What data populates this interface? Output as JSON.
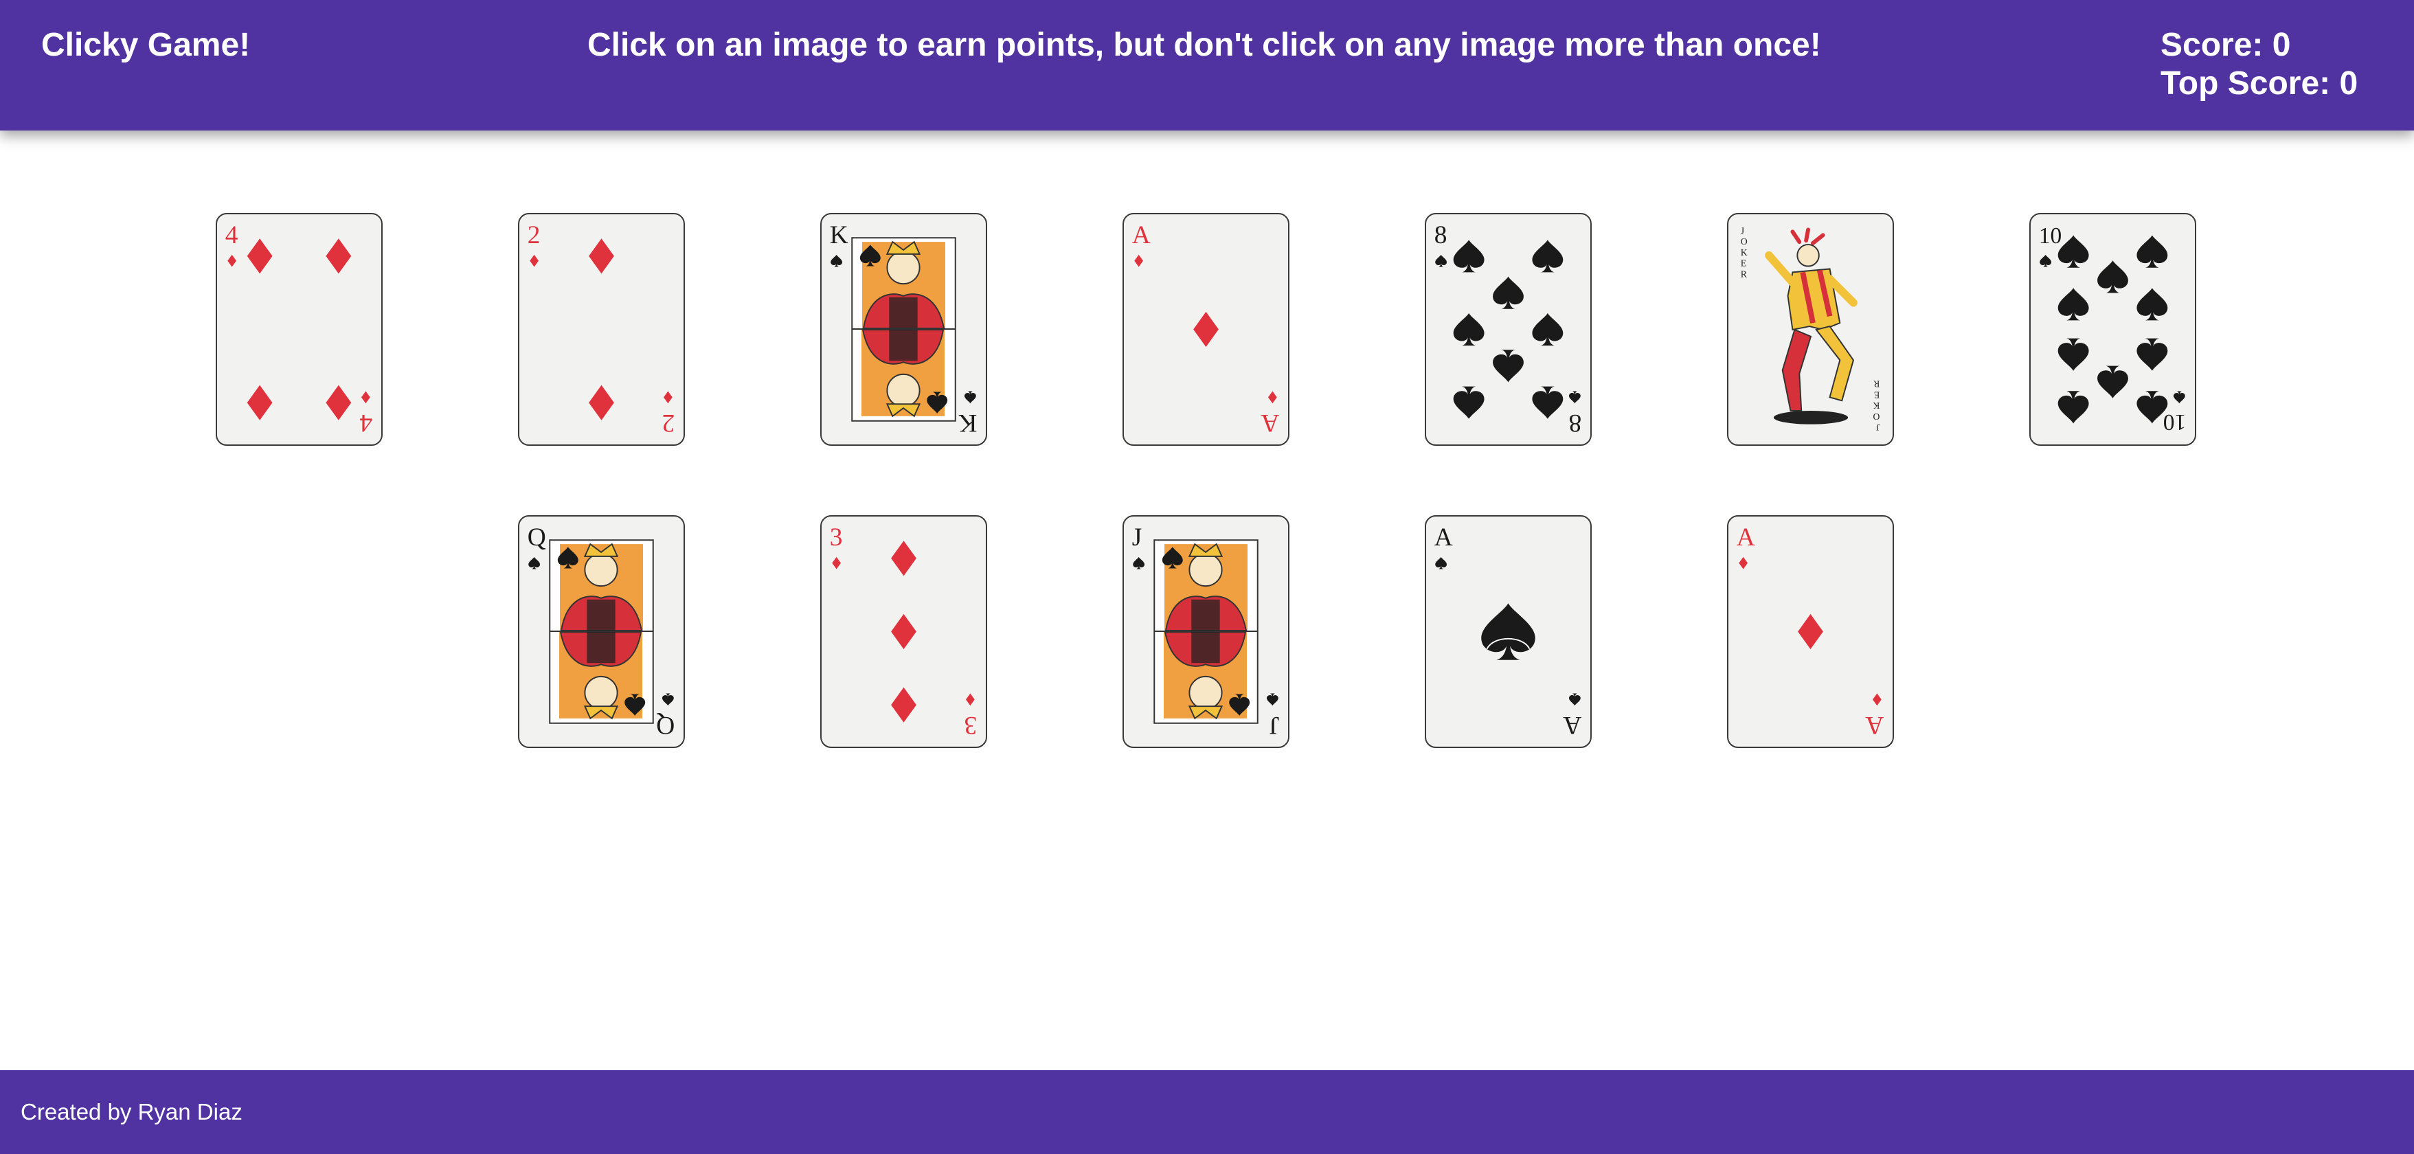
{
  "header": {
    "brand": "Clicky Game!",
    "instructions": "Click on an image to earn points, but don't click on any image more than once!",
    "score_label": "Score: 0",
    "top_score_label": "Top Score: 0"
  },
  "colors": {
    "accent": "#5033a0",
    "red": "#e0323c",
    "black": "#1a1a1a"
  },
  "cards": [
    {
      "rank": "4",
      "suit": "diamond"
    },
    {
      "rank": "2",
      "suit": "diamond"
    },
    {
      "rank": "K",
      "suit": "spade"
    },
    {
      "rank": "A",
      "suit": "diamond"
    },
    {
      "rank": "8",
      "suit": "spade"
    },
    {
      "rank": "JOKER",
      "suit": "joker"
    },
    {
      "rank": "10",
      "suit": "spade"
    },
    {
      "rank": "Q",
      "suit": "spade"
    },
    {
      "rank": "3",
      "suit": "diamond"
    },
    {
      "rank": "J",
      "suit": "spade"
    },
    {
      "rank": "A",
      "suit": "spade"
    },
    {
      "rank": "A",
      "suit": "diamond"
    }
  ],
  "footer": {
    "credit": "Created by Ryan Diaz"
  }
}
